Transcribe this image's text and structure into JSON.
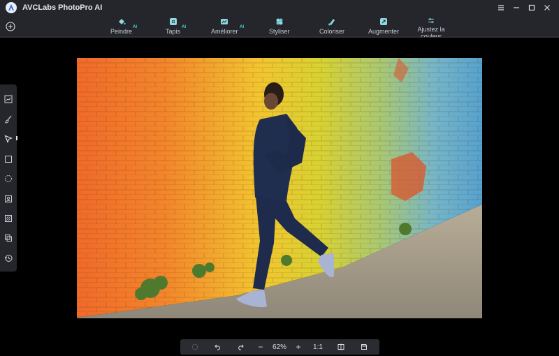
{
  "app": {
    "title": "AVCLabs PhotoPro AI"
  },
  "toolbar": {
    "tools": [
      {
        "label": "Peindre",
        "ai": "AI"
      },
      {
        "label": "Tapis",
        "ai": "AI"
      },
      {
        "label": "Améliorer",
        "ai": "AI"
      },
      {
        "label": "Styliser",
        "ai": ""
      },
      {
        "label": "Coloriser",
        "ai": ""
      },
      {
        "label": "Augmenter",
        "ai": ""
      },
      {
        "label": "Ajustez la couleur",
        "ai": ""
      }
    ]
  },
  "bottom_bar": {
    "zoom": "62%",
    "ratio": "1:1",
    "minus": "−",
    "plus": "+"
  },
  "colors": {
    "accent": "#49d3d8",
    "panel": "#24262b",
    "background": "#000000"
  }
}
